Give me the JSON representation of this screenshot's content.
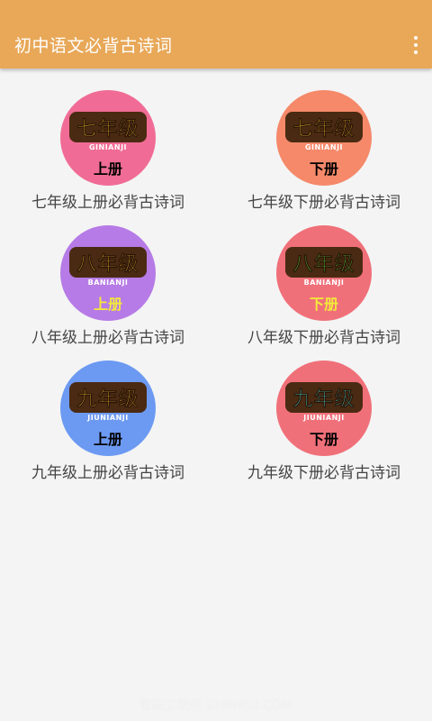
{
  "app": {
    "title": "初中语文必背古诗词"
  },
  "menu_icon": "more-vert-icon",
  "items": [
    {
      "grade": "七年级",
      "pinyin": "GINIANJI",
      "volume": "上册",
      "caption": "七年级上册必背古诗词",
      "circle_color": "#f06c96",
      "badge_color": "#f6c12e",
      "volume_color": "#000000"
    },
    {
      "grade": "七年级",
      "pinyin": "GINIANJI",
      "volume": "下册",
      "caption": "七年级下册必背古诗词",
      "circle_color": "#f5896a",
      "badge_color": "#f6c12e",
      "volume_color": "#000000"
    },
    {
      "grade": "八年级",
      "pinyin": "BANIANJI",
      "volume": "上册",
      "caption": "八年级上册必背古诗词",
      "circle_color": "#b67be6",
      "badge_color": "#f6c12e",
      "volume_color": "#f2ea3a"
    },
    {
      "grade": "八年级",
      "pinyin": "BANIANJI",
      "volume": "下册",
      "caption": "八年级下册必背古诗词",
      "circle_color": "#f0707a",
      "badge_color": "#5ee33a",
      "volume_color": "#f2ea3a"
    },
    {
      "grade": "九年级",
      "pinyin": "JIUNIANJI",
      "volume": "上册",
      "caption": "九年级上册必背古诗词",
      "circle_color": "#6c9af2",
      "badge_color": "#f6c12e",
      "volume_color": "#000000"
    },
    {
      "grade": "九年级",
      "pinyin": "JIUNIANJI",
      "volume": "下册",
      "caption": "九年级下册必背古诗词",
      "circle_color": "#f0707a",
      "badge_color": "#4fe6d8",
      "volume_color": "#000000"
    }
  ],
  "watermark": "智能工软件 ZHINRUI.COM"
}
